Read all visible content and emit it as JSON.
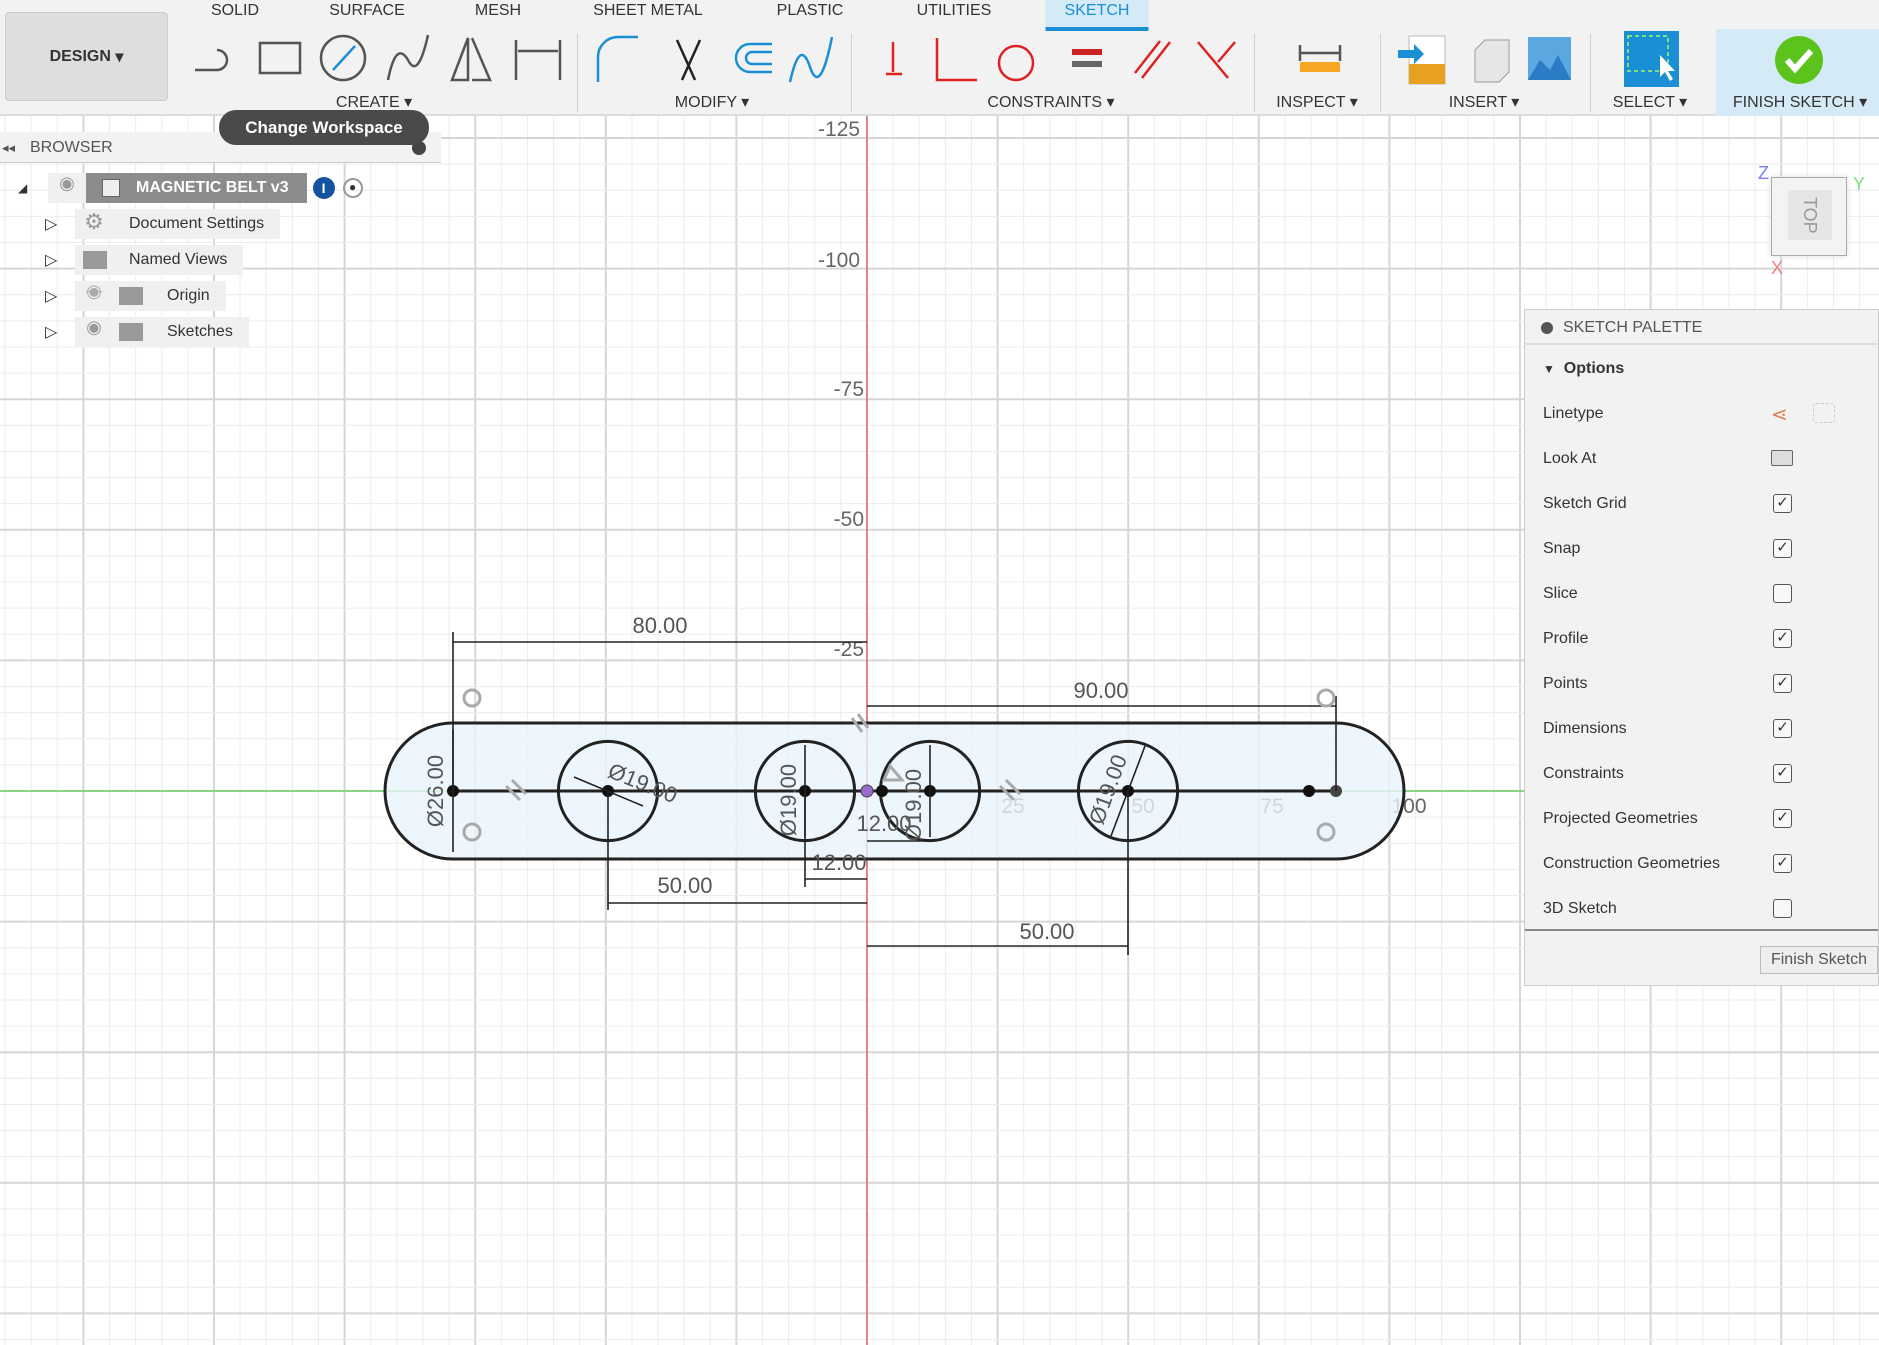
{
  "workspace": {
    "label": "DESIGN"
  },
  "tabs": [
    {
      "label": "SOLID",
      "active": false
    },
    {
      "label": "SURFACE",
      "active": false
    },
    {
      "label": "MESH",
      "active": false
    },
    {
      "label": "SHEET METAL",
      "active": false
    },
    {
      "label": "PLASTIC",
      "active": false
    },
    {
      "label": "UTILITIES",
      "active": false
    },
    {
      "label": "SKETCH",
      "active": true
    }
  ],
  "groups": {
    "create": "CREATE",
    "modify": "MODIFY",
    "constraints": "CONSTRAINTS",
    "inspect": "INSPECT",
    "insert": "INSERT",
    "select": "SELECT",
    "finish": "FINISH SKETCH"
  },
  "tooltip": "Change Workspace",
  "browser": {
    "title": "BROWSER",
    "root": "MAGNETIC BELT v3",
    "items": [
      {
        "label": "Document Settings",
        "icon": "gear-icon"
      },
      {
        "label": "Named Views",
        "icon": "folder-icon"
      },
      {
        "label": "Origin",
        "icon": "folder-icon",
        "visible": false
      },
      {
        "label": "Sketches",
        "icon": "folder-icon",
        "visible": true
      }
    ]
  },
  "viewcube": {
    "face": "TOP",
    "axes": [
      "Z",
      "Y",
      "X"
    ]
  },
  "rulers": {
    "vertical": [
      "-125",
      "-100",
      "-75",
      "-50",
      "-25"
    ],
    "horizontal": [
      "25",
      "50",
      "75",
      "100"
    ]
  },
  "dimensions": {
    "d80": "80.00",
    "d90": "90.00",
    "d50_left": "50.00",
    "d50_right": "50.00",
    "d12_outer": "12.00",
    "d12_inner": "12.00",
    "dia_slot": "Ø26.00",
    "dia1": "Ø19.00",
    "dia2": "Ø19.00",
    "dia3": "Ø19.00",
    "dia4": "Ø19.00"
  },
  "palette": {
    "title": "SKETCH PALETTE",
    "section": "Options",
    "linetype": "Linetype",
    "look_at": "Look At",
    "options": [
      {
        "label": "Sketch Grid",
        "checked": true
      },
      {
        "label": "Snap",
        "checked": true
      },
      {
        "label": "Slice",
        "checked": false
      },
      {
        "label": "Profile",
        "checked": true
      },
      {
        "label": "Points",
        "checked": true
      },
      {
        "label": "Dimensions",
        "checked": true
      },
      {
        "label": "Constraints",
        "checked": true
      },
      {
        "label": "Projected Geometries",
        "checked": true
      },
      {
        "label": "Construction Geometries",
        "checked": true
      },
      {
        "label": "3D Sketch",
        "checked": false
      }
    ],
    "finish_button": "Finish Sketch"
  },
  "colors": {
    "accent": "#1a8fd6",
    "x_axis": "#e05050",
    "y_axis": "#5bd35b",
    "profile_fill": "#e8f4fb",
    "finish": "#5cc31d"
  }
}
